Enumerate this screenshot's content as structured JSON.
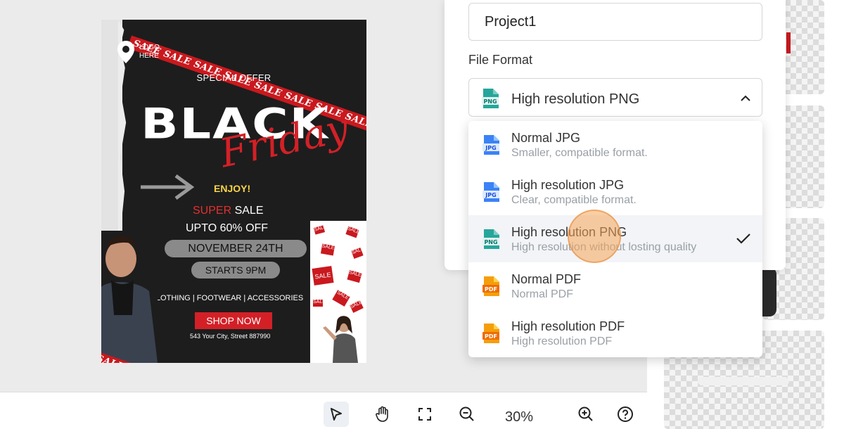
{
  "poster": {
    "ribbon_top": "SALE SALE SALE SALE SALE SALE SALE SALE SALE SALE SALE SALE",
    "ribbon_bottom": "SALE SALE SALE SALE SALE",
    "logo_line1": "LOGO",
    "logo_line2": "HERE",
    "special_offer": "SPECIAL OFFER",
    "title": "BLACK",
    "script_title": "Friday",
    "enjoy": "ENJOY!",
    "super_word": "SUPER",
    "sale_word": "SALE",
    "discount": "UPTO 60% OFF",
    "date": "NOVEMBER 24TH",
    "starts": "STARTS 9PM",
    "categories": "CLOTHING | FOOTWEAR | ACCESSORIES",
    "shop_now": "SHOP NOW",
    "address": "543 Your City, Street 887990",
    "sale_tag": "SALE"
  },
  "toolbar": {
    "zoom": "30%"
  },
  "export": {
    "filename": "Project1",
    "format_label": "File Format",
    "selected_format": "High resolution PNG",
    "selected_icon": "PNG",
    "options": [
      {
        "title": "Normal JPG",
        "subtitle": "Smaller, compatible format.",
        "icon": "JPG",
        "color": "#3b82f6"
      },
      {
        "title": "High resolution JPG",
        "subtitle": "Clear, compatible format.",
        "icon": "JPG",
        "color": "#3b82f6"
      },
      {
        "title": "High resolution PNG",
        "subtitle": "High resolution without losting quality",
        "icon": "PNG",
        "color": "#26a69a"
      },
      {
        "title": "Normal PDF",
        "subtitle": "Normal PDF",
        "icon": "PDF",
        "color": "#f59e0b"
      },
      {
        "title": "High resolution PDF",
        "subtitle": "High resolution PDF",
        "icon": "PDF",
        "color": "#f59e0b"
      }
    ]
  },
  "colors": {
    "accent_red": "#c9191e",
    "png_teal": "#26a69a",
    "jpg_blue": "#3b82f6",
    "pdf_orange": "#f59e0b",
    "cursor_highlight": "#f5a65a"
  }
}
